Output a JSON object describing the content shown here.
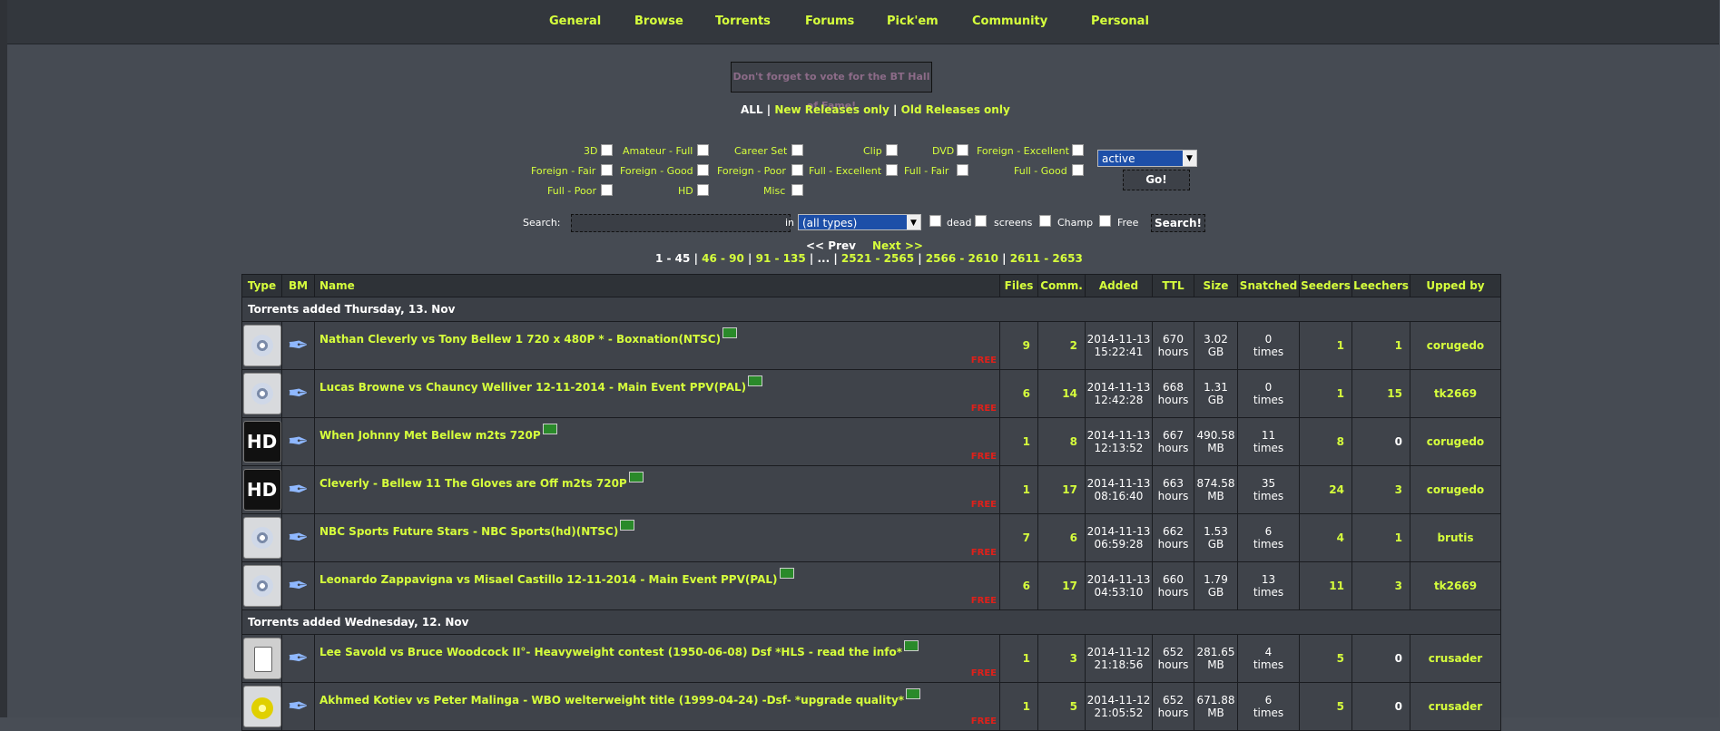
{
  "nav": [
    "General",
    "Browse",
    "Torrents",
    "Forums",
    "Pick'em",
    "Community",
    "Personal"
  ],
  "notice": "Don't forget to vote for the BT Hall of Fame!",
  "release_filter": {
    "all": "ALL",
    "sep": "|",
    "new": "New Releases only",
    "old": "Old Releases only"
  },
  "categories": [
    "3D",
    "Amateur - Full",
    "Career Set",
    "Clip",
    "DVD",
    "Foreign - Excellent",
    "Foreign - Fair",
    "Foreign - Good",
    "Foreign - Poor",
    "Full - Excellent",
    "Full - Fair",
    "Full - Good",
    "Full - Poor",
    "HD",
    "Misc"
  ],
  "status_select": "active",
  "go_label": "Go!",
  "search": {
    "label": "Search:",
    "in": "in",
    "type_select": "(all types)",
    "dead": "dead",
    "screens": "screens",
    "champ": "Champ",
    "free": "Free",
    "button": "Search!"
  },
  "pager": {
    "prev": "<< Prev",
    "next": "Next >>",
    "current": "1 - 45",
    "pages": [
      "46 - 90",
      "91 - 135",
      "...",
      "2521 - 2565",
      "2566 - 2610",
      "2611 - 2653"
    ]
  },
  "columns": [
    "Type",
    "BM",
    "Name",
    "Files",
    "Comm.",
    "Added",
    "TTL",
    "Size",
    "Snatched",
    "Seeders",
    "Leechers",
    "Upped by"
  ],
  "groups": [
    {
      "heading": "Torrents added Thursday, 13. Nov",
      "rows": [
        {
          "icon": "dvd-icon",
          "name": "Nathan Cleverly vs Tony Bellew 1 720 x 480P * - Boxnation(NTSC)",
          "free": "FREE",
          "files": "9",
          "comm": "2",
          "date": "2014-11-13",
          "time": "15:22:41",
          "ttl": "670",
          "ttl_unit": "hours",
          "size": "3.02",
          "size_unit": "GB",
          "snatched": "0",
          "snatched_unit": "times",
          "seeders": "1",
          "leechers": "1",
          "upper": "corugedo"
        },
        {
          "icon": "dvd-icon",
          "name": "Lucas Browne vs Chauncy Welliver 12-11-2014 - Main Event PPV(PAL)",
          "free": "FREE",
          "files": "6",
          "comm": "14",
          "date": "2014-11-13",
          "time": "12:42:28",
          "ttl": "668",
          "ttl_unit": "hours",
          "size": "1.31",
          "size_unit": "GB",
          "snatched": "0",
          "snatched_unit": "times",
          "seeders": "1",
          "leechers": "15",
          "upper": "tk2669"
        },
        {
          "icon": "hd-icon",
          "name": "When Johnny Met Bellew m2ts 720P",
          "free": "FREE",
          "files": "1",
          "comm": "8",
          "date": "2014-11-13",
          "time": "12:13:52",
          "ttl": "667",
          "ttl_unit": "hours",
          "size": "490.58",
          "size_unit": "MB",
          "snatched": "11",
          "snatched_unit": "times",
          "seeders": "8",
          "leechers": "0",
          "upper": "corugedo"
        },
        {
          "icon": "hd-icon",
          "name": "Cleverly - Bellew 11 The Gloves are Off m2ts 720P",
          "free": "FREE",
          "files": "1",
          "comm": "17",
          "date": "2014-11-13",
          "time": "08:16:40",
          "ttl": "663",
          "ttl_unit": "hours",
          "size": "874.58",
          "size_unit": "MB",
          "snatched": "35",
          "snatched_unit": "times",
          "seeders": "24",
          "leechers": "3",
          "upper": "corugedo"
        },
        {
          "icon": "dvd-icon",
          "name": "NBC Sports Future Stars - NBC Sports(hd)(NTSC)",
          "free": "FREE",
          "files": "7",
          "comm": "6",
          "date": "2014-11-13",
          "time": "06:59:28",
          "ttl": "662",
          "ttl_unit": "hours",
          "size": "1.53",
          "size_unit": "GB",
          "snatched": "6",
          "snatched_unit": "times",
          "seeders": "4",
          "leechers": "1",
          "upper": "brutis"
        },
        {
          "icon": "dvd-icon",
          "name": "Leonardo Zappavigna vs Misael Castillo 12-11-2014 - Main Event PPV(PAL)",
          "free": "FREE",
          "files": "6",
          "comm": "17",
          "date": "2014-11-13",
          "time": "04:53:10",
          "ttl": "660",
          "ttl_unit": "hours",
          "size": "1.79",
          "size_unit": "GB",
          "snatched": "13",
          "snatched_unit": "times",
          "seeders": "11",
          "leechers": "3",
          "upper": "tk2669"
        }
      ]
    },
    {
      "heading": "Torrents added Wednesday, 12. Nov",
      "rows": [
        {
          "icon": "classic-icon",
          "name": "Lee Savold vs Bruce Woodcock II°- Heavyweight contest (1950-06-08) Dsf *HLS - read the info*",
          "free": "FREE",
          "files": "1",
          "comm": "3",
          "date": "2014-11-12",
          "time": "21:18:56",
          "ttl": "652",
          "ttl_unit": "hours",
          "size": "281.65",
          "size_unit": "MB",
          "snatched": "4",
          "snatched_unit": "times",
          "seeders": "5",
          "leechers": "0",
          "upper": "crusader"
        },
        {
          "icon": "medal-icon",
          "name": "Akhmed Kotiev vs Peter Malinga - WBO welterweight title (1999-04-24) -Dsf- *upgrade quality*",
          "free": "FREE",
          "files": "1",
          "comm": "5",
          "date": "2014-11-12",
          "time": "21:05:52",
          "ttl": "652",
          "ttl_unit": "hours",
          "size": "671.88",
          "size_unit": "MB",
          "snatched": "6",
          "snatched_unit": "times",
          "seeders": "5",
          "leechers": "0",
          "upper": "crusader"
        }
      ]
    }
  ]
}
